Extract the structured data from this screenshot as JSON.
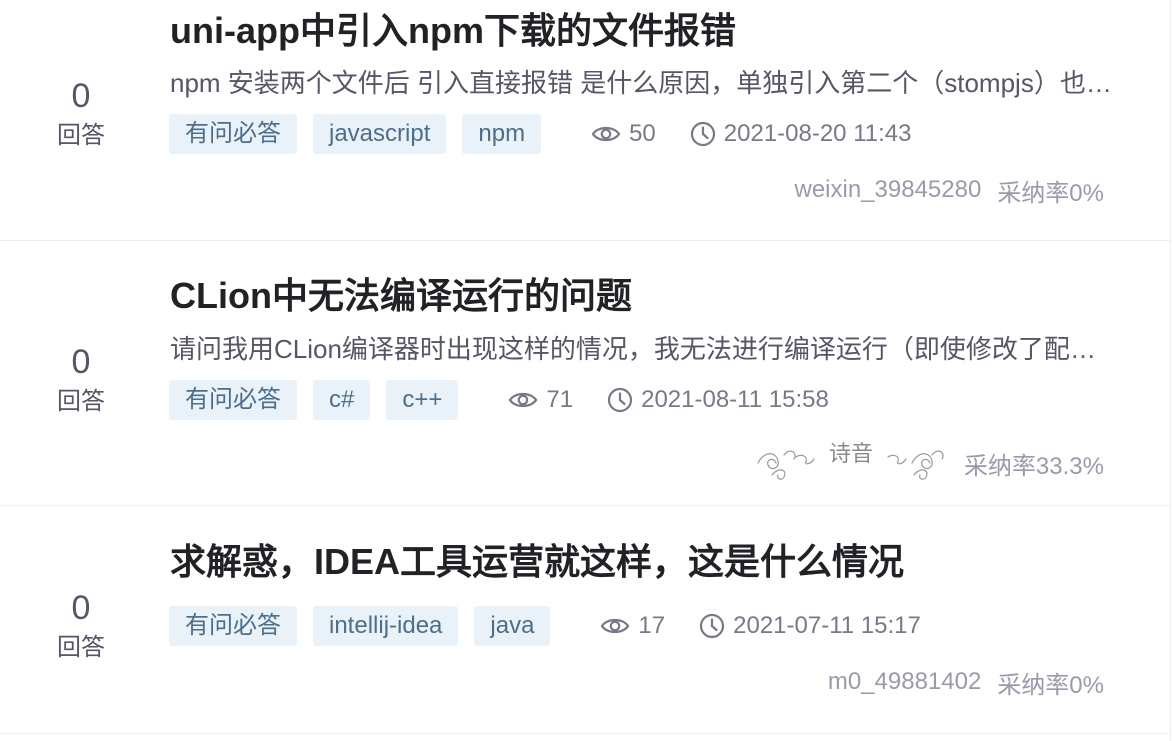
{
  "questions": [
    {
      "answers": "0",
      "answers_label": "回答",
      "title": "uni-app中引入npm下载的文件报错",
      "desc": "npm 安装两个文件后 引入直接报错 是什么原因，单独引入第二个（stompjs）也报错",
      "tags": [
        "有问必答",
        "javascript",
        "npm"
      ],
      "views": "50",
      "time": "2021-08-20 11:43",
      "user": "weixin_39845280",
      "accept_rate": "采纳率0%"
    },
    {
      "answers": "0",
      "answers_label": "回答",
      "title": "CLion中无法编译运行的问题",
      "desc": "请问我用CLion编译器时出现这样的情况，我无法进行编译运行（即使修改了配置）",
      "tags": [
        "有问必答",
        "c#",
        "c++"
      ],
      "views": "71",
      "time": "2021-08-11 15:58",
      "user_signature": "诗音",
      "accept_rate": "采纳率33.3%"
    },
    {
      "answers": "0",
      "answers_label": "回答",
      "title": "求解惑，IDEA工具运营就这样，这是什么情况",
      "tags": [
        "有问必答",
        "intellij-idea",
        "java"
      ],
      "views": "17",
      "time": "2021-07-11 15:17",
      "user": "m0_49881402",
      "accept_rate": "采纳率0%"
    }
  ],
  "icons": {
    "views": "eye-icon",
    "time": "clock-icon"
  },
  "colors": {
    "tag_bg": "#eaf2f9",
    "tag_text": "#4d6e8a",
    "title": "#222226",
    "meta": "#999aaa"
  }
}
